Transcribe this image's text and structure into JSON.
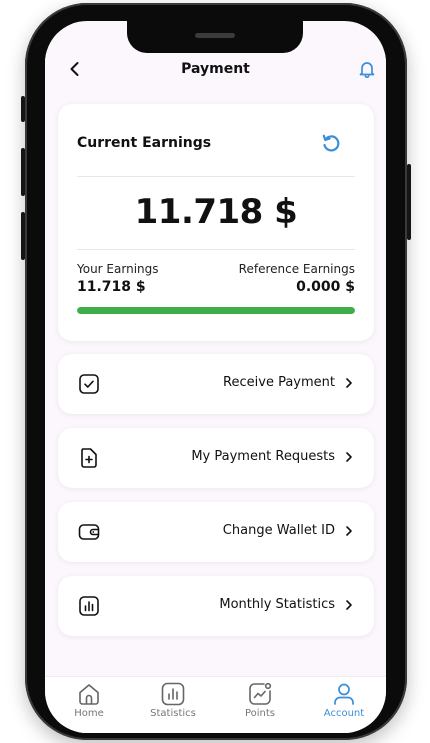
{
  "header": {
    "title": "Payment",
    "back_icon": "chevron-left-icon",
    "notify_icon": "bell-icon"
  },
  "earnings": {
    "label": "Current Earnings",
    "total": "11.718 $",
    "your_label": "Your Earnings",
    "your_value": "11.718 $",
    "ref_label": "Reference Earnings",
    "ref_value": "0.000 $",
    "progress_fraction": 1.0,
    "progress_color": "#3fae4a"
  },
  "menu": [
    {
      "label": "Receive Payment",
      "icon": "checkbox-icon"
    },
    {
      "label": "My Payment Requests",
      "icon": "file-plus-icon"
    },
    {
      "label": "Change Wallet ID",
      "icon": "wallet-icon"
    },
    {
      "label": "Monthly Statistics",
      "icon": "bar-chart-icon"
    }
  ],
  "nav": [
    {
      "label": "Home",
      "icon": "home-icon"
    },
    {
      "label": "Statistics",
      "icon": "statistics-icon"
    },
    {
      "label": "Points",
      "icon": "points-icon"
    },
    {
      "label": "Account",
      "icon": "user-icon",
      "active": true
    }
  ],
  "colors": {
    "accent": "#3a8fd8",
    "progress": "#3fae4a"
  }
}
